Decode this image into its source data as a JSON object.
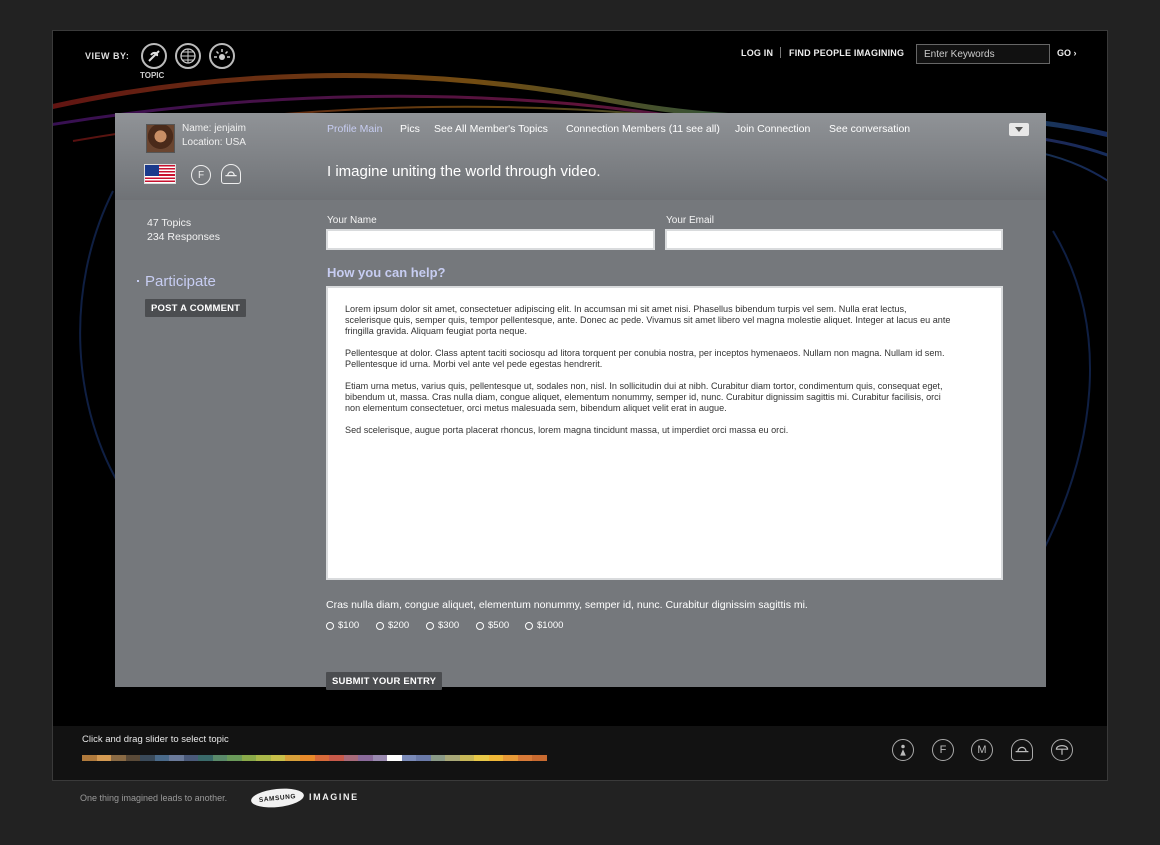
{
  "topbar": {
    "view_by_label": "VIEW BY:",
    "view_icons": [
      "topic-icon",
      "globe-icon",
      "sun-icon"
    ],
    "topic_caption": "TOPIC",
    "login": "LOG IN",
    "find_people": "FIND PEOPLE IMAGINING",
    "search_placeholder": "Enter Keywords",
    "go": "GO ›"
  },
  "profile": {
    "name": "Name: jenjaim",
    "location": "Location: USA",
    "gender_icon": "female-icon",
    "hat_icon": "hat-icon",
    "flag_icon": "usa-flag-icon"
  },
  "tabs": [
    {
      "label": "Profile Main",
      "active": true
    },
    {
      "label": "Pics",
      "active": false
    },
    {
      "label": "See All Member's Topics",
      "active": false
    },
    {
      "label": "Connection Members (11 see all)",
      "active": false
    },
    {
      "label": "Join Connection",
      "active": false
    },
    {
      "label": "See conversation",
      "active": false
    }
  ],
  "headline": "I imagine uniting the world through video.",
  "sidebar": {
    "topics": "47 Topics",
    "responses": "234 Responses",
    "participate": "Participate",
    "post_comment": "POST A COMMENT"
  },
  "form": {
    "name_label": "Your Name",
    "email_label": "Your Email",
    "name_value": "",
    "email_value": "",
    "help_title": "How you can help?",
    "paragraphs": [
      "Lorem ipsum dolor sit amet, consectetuer adipiscing elit. In accumsan mi sit amet nisi. Phasellus bibendum turpis vel sem. Nulla erat lectus, scelerisque quis, semper quis, tempor pellentesque, ante. Donec ac pede. Vivamus sit amet libero vel magna molestie aliquet. Integer at lacus eu ante fringilla gravida. Aliquam feugiat porta neque.",
      "Pellentesque at dolor. Class aptent taciti sociosqu ad litora torquent per conubia nostra, per inceptos hymenaeos. Nullam non magna. Nullam id sem. Pellentesque id urna. Morbi vel ante vel pede egestas hendrerit.",
      "Etiam urna metus, varius quis, pellentesque ut, sodales non, nisl. In sollicitudin dui at nibh. Curabitur diam tortor, condimentum quis, consequat eget, bibendum ut, massa. Cras nulla diam, congue aliquet, elementum nonummy, semper id, nunc. Curabitur dignissim sagittis mi. Curabitur facilisis, orci non elementum consectetuer, orci metus malesuada sem, bibendum aliquet velit erat in augue.",
      "Sed scelerisque, augue porta placerat rhoncus, lorem magna tincidunt massa, ut imperdiet orci massa eu orci."
    ],
    "prompt": "Cras nulla diam, congue aliquet, elementum nonummy, semper id, nunc. Curabitur dignissim sagittis mi.",
    "amounts": [
      "$100",
      "$200",
      "$300",
      "$500",
      "$1000"
    ],
    "submit": "SUBMIT YOUR ENTRY"
  },
  "footer": {
    "slider_label": "Click and drag slider to select topic",
    "slider_colors": [
      "#b07a3c",
      "#d49a52",
      "#8a6a44",
      "#5a4a38",
      "#3a4a5a",
      "#4a6a8a",
      "#6a7a9a",
      "#4a5a7a",
      "#3a6a6a",
      "#5a8a6a",
      "#6a9a5a",
      "#8aaa4a",
      "#aab84a",
      "#c8c04a",
      "#d8a03a",
      "#e88a2a",
      "#d86a3a",
      "#c85a4a",
      "#a86a7a",
      "#8a6a9a",
      "#9a8ab0",
      "#ffffff",
      "#7a8ab8",
      "#6a7aa8",
      "#8a9a88",
      "#a8a878",
      "#c8b858",
      "#e8c848",
      "#f0b838",
      "#e89a38",
      "#d87a38",
      "#c86a30"
    ],
    "topic_icons": [
      "person-icon",
      "female-icon",
      "male-icon",
      "hat-icon",
      "umbrella-icon"
    ],
    "tagline": "One thing imagined leads to another.",
    "brand_oval": "SAMSUNG",
    "brand_word": "IMAGINE"
  }
}
